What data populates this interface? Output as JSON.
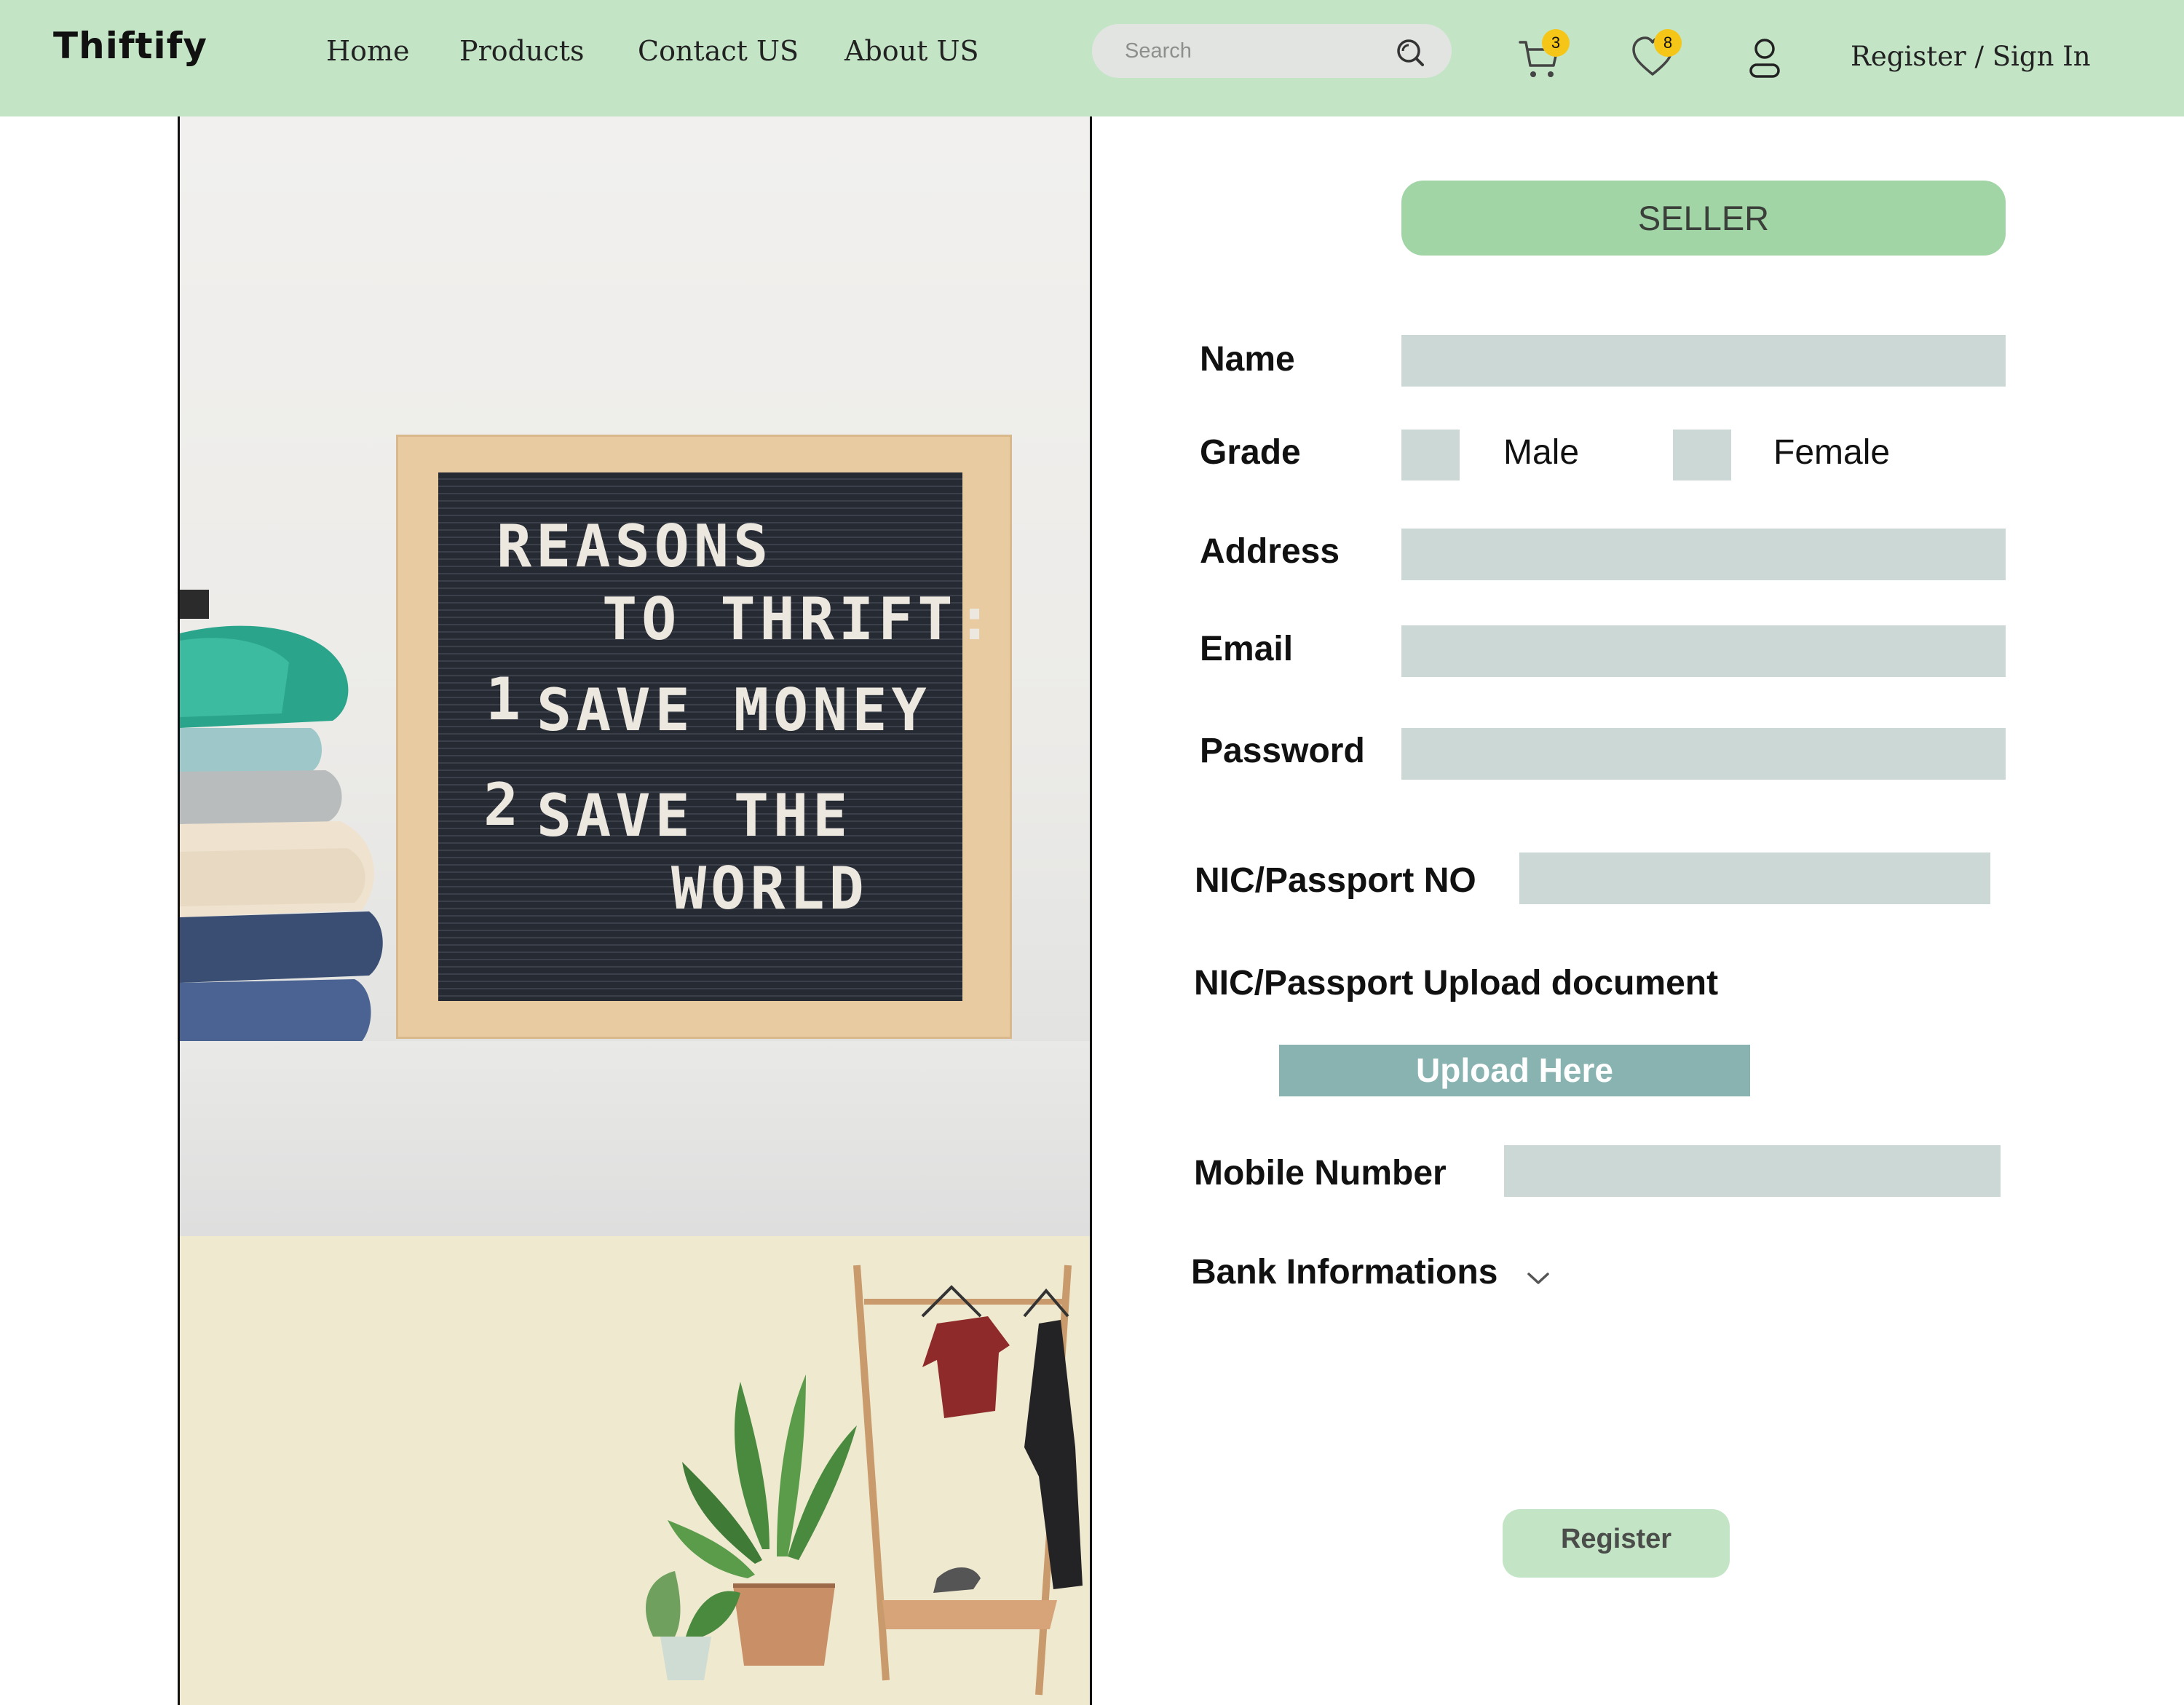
{
  "nav": {
    "logo": "Thiftify",
    "links": [
      "Home",
      "Products",
      "Contact US",
      "About US"
    ],
    "search_placeholder": "Search",
    "cart_count": "3",
    "wishlist_count": "8",
    "signin": "Register / Sign In",
    "background": "#c3e5c6"
  },
  "hero": {
    "board_lines": [
      "REASONS",
      "TO THRIFT:",
      "1",
      "SAVE MONEY",
      "2",
      "SAVE THE",
      "WORLD"
    ]
  },
  "form": {
    "role_button": "SELLER",
    "name_label": "Name",
    "grade_label": "Grade",
    "male_label": "Male",
    "female_label": "Female",
    "address_label": "Address",
    "email_label": "Email",
    "password_label": "Password",
    "nic_label": "NIC/Passport NO",
    "nic_upload_label": "NIC/Passport Upload document",
    "upload_button": "Upload Here",
    "mobile_label": "Mobile Number",
    "bank_label": "Bank Informations",
    "register_button": "Register",
    "field_color": "#cbd8d6",
    "accent": "#a2d5a6"
  }
}
